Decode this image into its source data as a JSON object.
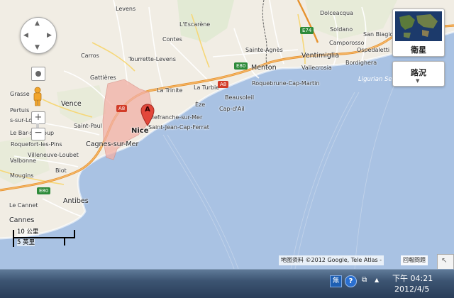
{
  "map": {
    "places": {
      "levens": "Levens",
      "lescarene": "L'Escarène",
      "contes": "Contes",
      "tourrette": "Tourrette-Levens",
      "carros": "Carros",
      "gattieres": "Gattières",
      "vence": "Vence",
      "saintpaul": "Saint-Paul",
      "cagnes": "Cagnes-sur-Mer",
      "nice": "Nice",
      "latrinite": "La Trinite",
      "laturbie": "La Turbie",
      "beausoleil": "Beausoleil",
      "eze": "Èze",
      "capdail": "Cap-d'Ail",
      "villefranche": "Villefranche-sur-Mer",
      "stjeancap": "Saint-Jean-Cap-Ferrat",
      "saintagnes": "Sainte-Agnès",
      "menton": "Menton",
      "roquebrune": "Roquebrune-Cap-Martin",
      "ventimiglia": "Ventimiglia",
      "vallecrosia": "Vallecrosia",
      "dolceacqua": "Dolceacqua",
      "soldano": "Soldano",
      "camporosso": "Camporosso",
      "sanbiagio": "San Biagio",
      "ospedaletti": "Ospedaletti",
      "bordighera": "Bordighera",
      "ligurian": "Ligurian Se",
      "cloup": "s-sur-Loup",
      "sloup": "Le Bar-sur-Loup",
      "roquefort": "Roquefort-les-Pins",
      "villeneuve": "Villeneuve-Loubet",
      "biot": "Biot",
      "antibes": "Antibes",
      "lecannet": "Le Cannet",
      "cannes": "Cannes",
      "valbonne": "Valbonne",
      "mougins": "Mougins",
      "grasse": "Grasse",
      "pertuis": "Pertuis"
    },
    "roads": {
      "a8_west": "A8",
      "a8_east": "A8",
      "e80_east": "E80",
      "e80_west": "E80",
      "e74": "E74"
    },
    "marker_label": "A",
    "scale": {
      "metric": "10 公里",
      "imperial": "5 英里"
    },
    "attribution": "地图资料 ©2012 Google, Tele Atlas -",
    "report_label": "回報問題",
    "satellite_label": "衛星",
    "traffic_label": "路況"
  },
  "taskbar": {
    "time": "下午 04:21",
    "date": "2012/4/5",
    "ime_label": "無",
    "help_label": "?"
  },
  "colors": {
    "sea": "#a9c2e3",
    "land": "#f0ede5",
    "highlight": "#f4b8b0",
    "motorway": "#f0a040"
  }
}
